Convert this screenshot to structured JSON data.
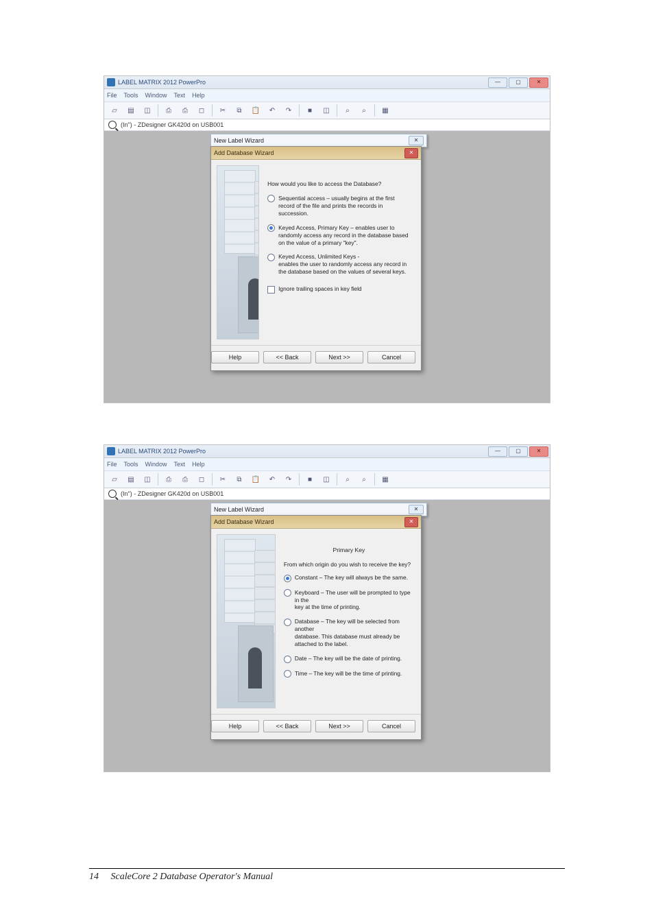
{
  "app_title": "LABEL MATRIX 2012 PowerPro",
  "menus": [
    "File",
    "Tools",
    "Window",
    "Text",
    "Help"
  ],
  "infobar": "(In\") - ZDesigner GK420d on USB001",
  "behind_title": "New Label Wizard",
  "wizard_title": "Add Database Wizard",
  "buttons": {
    "help": "Help",
    "back": "<< Back",
    "next": "Next >>",
    "cancel": "Cancel"
  },
  "shot1": {
    "question": "How would you like to access the Database?",
    "opt1_t": "Sequential access – usually begins at the first",
    "opt1_d": "record of the file and prints the records in succession.",
    "opt2_t": "Keyed Access, Primary Key – enables user to",
    "opt2_d": "randomly access any record in the database based on the value of a primary \"key\".",
    "opt3_t": "Keyed Access, Unlimited Keys -",
    "opt3_d": "enables the user to randomly access any record in the database based on the values of several keys.",
    "chk": "Ignore trailing spaces in key field"
  },
  "shot2": {
    "heading": "Primary Key",
    "question": "From which origin do you wish to receive the key?",
    "opt1": "Constant – The key will always be the same.",
    "opt2_t": "Keyboard – The user will be prompted to type in the",
    "opt2_d": "key at the time of printing.",
    "opt3_t": "Database – The key will be selected from another",
    "opt3_d": "database. This database must already be attached to the label.",
    "opt4": "Date – The key will be the date of printing.",
    "opt5": "Time – The key will be the time of printing."
  },
  "footer": {
    "page": "14",
    "title": "ScaleCore 2 Database Operator's Manual"
  }
}
